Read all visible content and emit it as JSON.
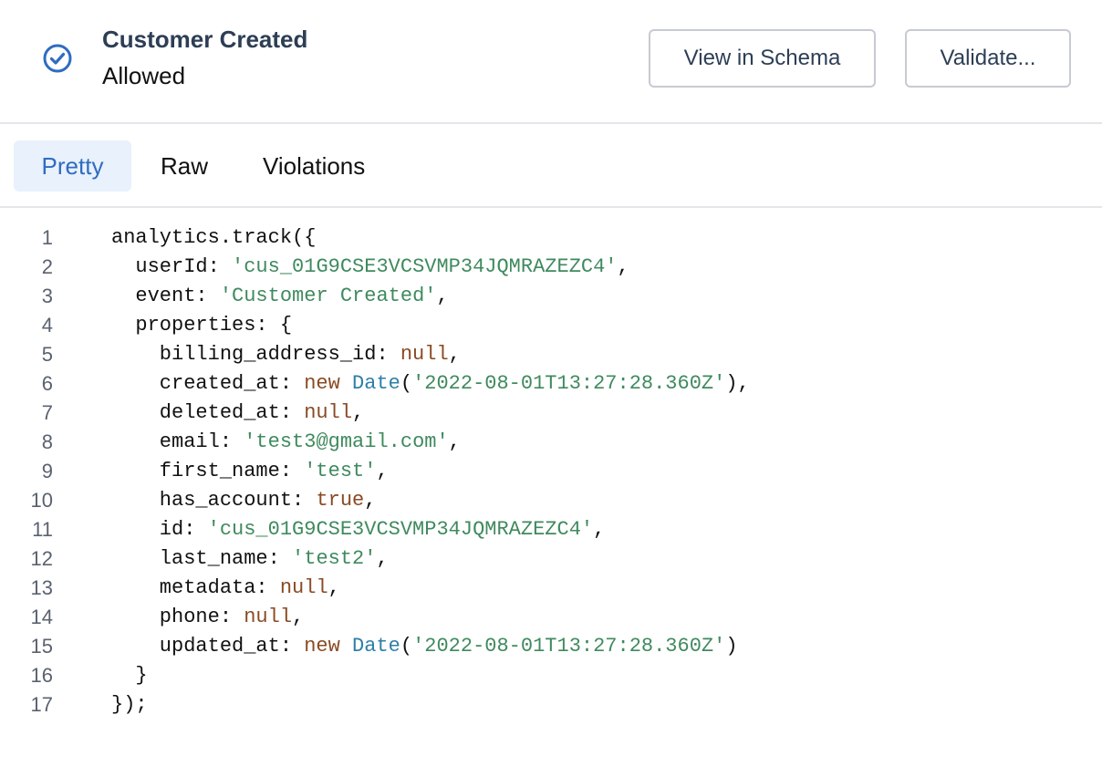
{
  "header": {
    "status_icon": "check-circle-icon",
    "title": "Customer Created",
    "status": "Allowed",
    "view_schema_label": "View in Schema",
    "validate_label": "Validate..."
  },
  "tabs": [
    {
      "label": "Pretty",
      "active": true
    },
    {
      "label": "Raw",
      "active": false
    },
    {
      "label": "Violations",
      "active": false
    }
  ],
  "colors": {
    "accent": "#2f6cc1",
    "string": "#3f8a5e",
    "keyword": "#8a4a22",
    "class": "#2e7fa8"
  },
  "code": {
    "lines": [
      {
        "n": "1",
        "tokens": [
          {
            "t": "analytics.track({",
            "k": "plain"
          }
        ]
      },
      {
        "n": "2",
        "tokens": [
          {
            "t": "  userId: ",
            "k": "plain"
          },
          {
            "t": "'cus_01G9CSE3VCSVMP34JQMRAZEZC4'",
            "k": "str"
          },
          {
            "t": ",",
            "k": "plain"
          }
        ]
      },
      {
        "n": "3",
        "tokens": [
          {
            "t": "  event: ",
            "k": "plain"
          },
          {
            "t": "'Customer Created'",
            "k": "str"
          },
          {
            "t": ",",
            "k": "plain"
          }
        ]
      },
      {
        "n": "4",
        "tokens": [
          {
            "t": "  properties: {",
            "k": "plain"
          }
        ]
      },
      {
        "n": "5",
        "tokens": [
          {
            "t": "    billing_address_id: ",
            "k": "plain"
          },
          {
            "t": "null",
            "k": "kw"
          },
          {
            "t": ",",
            "k": "plain"
          }
        ]
      },
      {
        "n": "6",
        "tokens": [
          {
            "t": "    created_at: ",
            "k": "plain"
          },
          {
            "t": "new",
            "k": "kw"
          },
          {
            "t": " ",
            "k": "plain"
          },
          {
            "t": "Date",
            "k": "cls"
          },
          {
            "t": "(",
            "k": "plain"
          },
          {
            "t": "'2022-08-01T13:27:28.360Z'",
            "k": "str"
          },
          {
            "t": "),",
            "k": "plain"
          }
        ]
      },
      {
        "n": "7",
        "tokens": [
          {
            "t": "    deleted_at: ",
            "k": "plain"
          },
          {
            "t": "null",
            "k": "kw"
          },
          {
            "t": ",",
            "k": "plain"
          }
        ]
      },
      {
        "n": "8",
        "tokens": [
          {
            "t": "    email: ",
            "k": "plain"
          },
          {
            "t": "'test3@gmail.com'",
            "k": "str"
          },
          {
            "t": ",",
            "k": "plain"
          }
        ]
      },
      {
        "n": "9",
        "tokens": [
          {
            "t": "    first_name: ",
            "k": "plain"
          },
          {
            "t": "'test'",
            "k": "str"
          },
          {
            "t": ",",
            "k": "plain"
          }
        ]
      },
      {
        "n": "10",
        "tokens": [
          {
            "t": "    has_account: ",
            "k": "plain"
          },
          {
            "t": "true",
            "k": "kw"
          },
          {
            "t": ",",
            "k": "plain"
          }
        ]
      },
      {
        "n": "11",
        "tokens": [
          {
            "t": "    id: ",
            "k": "plain"
          },
          {
            "t": "'cus_01G9CSE3VCSVMP34JQMRAZEZC4'",
            "k": "str"
          },
          {
            "t": ",",
            "k": "plain"
          }
        ]
      },
      {
        "n": "12",
        "tokens": [
          {
            "t": "    last_name: ",
            "k": "plain"
          },
          {
            "t": "'test2'",
            "k": "str"
          },
          {
            "t": ",",
            "k": "plain"
          }
        ]
      },
      {
        "n": "13",
        "tokens": [
          {
            "t": "    metadata: ",
            "k": "plain"
          },
          {
            "t": "null",
            "k": "kw"
          },
          {
            "t": ",",
            "k": "plain"
          }
        ]
      },
      {
        "n": "14",
        "tokens": [
          {
            "t": "    phone: ",
            "k": "plain"
          },
          {
            "t": "null",
            "k": "kw"
          },
          {
            "t": ",",
            "k": "plain"
          }
        ]
      },
      {
        "n": "15",
        "tokens": [
          {
            "t": "    updated_at: ",
            "k": "plain"
          },
          {
            "t": "new",
            "k": "kw"
          },
          {
            "t": " ",
            "k": "plain"
          },
          {
            "t": "Date",
            "k": "cls"
          },
          {
            "t": "(",
            "k": "plain"
          },
          {
            "t": "'2022-08-01T13:27:28.360Z'",
            "k": "str"
          },
          {
            "t": ")",
            "k": "plain"
          }
        ]
      },
      {
        "n": "16",
        "tokens": [
          {
            "t": "  }",
            "k": "plain"
          }
        ]
      },
      {
        "n": "17",
        "tokens": [
          {
            "t": "});",
            "k": "plain"
          }
        ]
      }
    ]
  }
}
